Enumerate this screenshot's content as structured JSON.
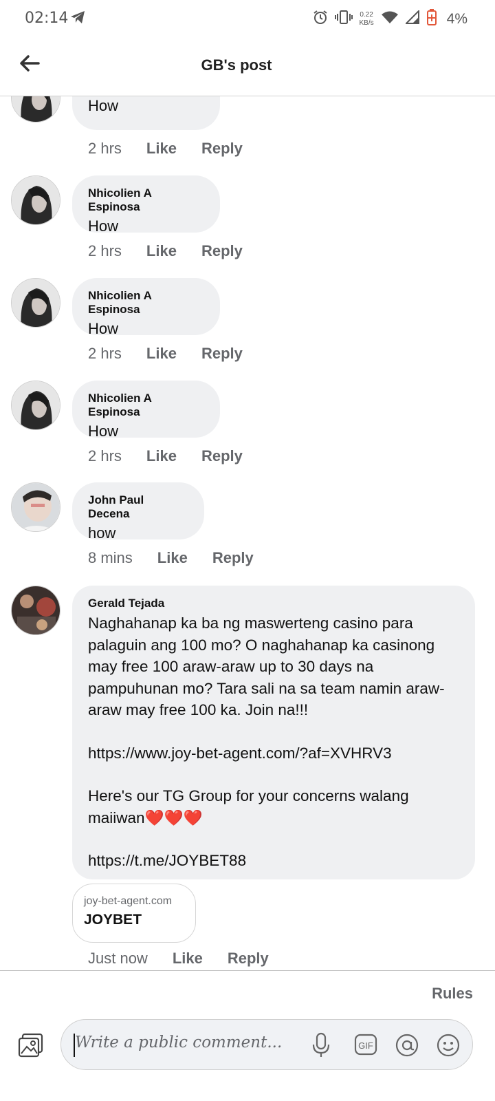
{
  "status_bar": {
    "time": "02:14",
    "speed_value": "0.22",
    "speed_unit": "KB/s",
    "battery": "4%",
    "icons": [
      "telegram-icon",
      "alarm-icon",
      "vibrate-icon",
      "wifi-icon",
      "signal-icon",
      "battery-icon"
    ]
  },
  "header": {
    "title": "GB's post",
    "back_icon": "arrow-left-icon"
  },
  "comments": [
    {
      "name": "",
      "text": "How",
      "time": "2 hrs",
      "like": "Like",
      "reply": "Reply"
    },
    {
      "name": "Nhicolien A Espinosa",
      "text": "How",
      "time": "2 hrs",
      "like": "Like",
      "reply": "Reply"
    },
    {
      "name": "Nhicolien A Espinosa",
      "text": "How",
      "time": "2 hrs",
      "like": "Like",
      "reply": "Reply"
    },
    {
      "name": "Nhicolien A Espinosa",
      "text": "How",
      "time": "2 hrs",
      "like": "Like",
      "reply": "Reply"
    },
    {
      "name": "John Paul Decena",
      "text": "how",
      "time": "8 mins",
      "like": "Like",
      "reply": "Reply"
    },
    {
      "name": "Gerald Tejada",
      "text": "Naghahanap ka ba ng maswerteng casino para palaguin ang 100 mo? O naghahanap ka casinong may free 100 araw-araw up to 30 days na pampuhunan mo? Tara sali na sa team namin araw-araw may free 100 ka. Join na!!!",
      "link1": "https://www.joy-bet-agent.com/?af=XVHRV3",
      "text2": "Here's our TG Group for your concerns walang maiiwan",
      "hearts": "❤️❤️❤️",
      "link2": "https://t.me/JOYBET88",
      "preview_domain": "joy-bet-agent.com",
      "preview_title": "JOYBET",
      "time": "Just now",
      "like": "Like",
      "reply": "Reply"
    }
  ],
  "bottom": {
    "rules": "Rules",
    "placeholder": "Write a public comment...",
    "icons": [
      "photo-icon",
      "microphone-icon",
      "gif-icon",
      "mention-icon",
      "emoji-icon"
    ],
    "gif_label": "GIF"
  },
  "colors": {
    "bubble": "#eff0f2",
    "link": "#2a5db0",
    "meta_text": "#65676b",
    "battery_accent": "#e2573a"
  }
}
